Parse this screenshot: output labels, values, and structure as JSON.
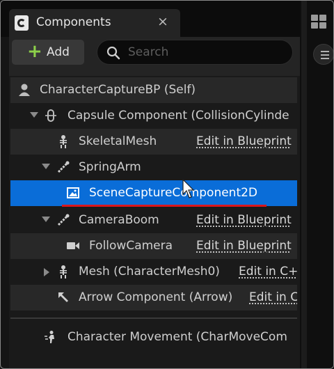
{
  "tab": {
    "title": "Components",
    "close": "×"
  },
  "toolbar": {
    "add_label": "Add",
    "add_plus": "+",
    "search_placeholder": "Search"
  },
  "tree": {
    "rows": [
      {
        "label": "CharacterCaptureBP (Self)",
        "icon": "actor-icon",
        "action": ""
      },
      {
        "label": "Capsule Component (CollisionCylinde",
        "icon": "capsule-icon",
        "action": ""
      },
      {
        "label": "SkeletalMesh",
        "icon": "skeleton-icon",
        "action": "Edit in Blueprint"
      },
      {
        "label": "SpringArm",
        "icon": "spring-arm-icon",
        "action": ""
      },
      {
        "label": "SceneCaptureComponent2D",
        "icon": "scene-capture-icon",
        "action": ""
      },
      {
        "label": "CameraBoom",
        "icon": "spring-arm-icon",
        "action": "Edit in Blueprint"
      },
      {
        "label": "FollowCamera",
        "icon": "camera-icon",
        "action": "Edit in Blueprint"
      },
      {
        "label": "Mesh (CharacterMesh0)",
        "icon": "skeleton-icon",
        "action": "Edit in C+"
      },
      {
        "label": "Arrow Component (Arrow)",
        "icon": "arrow-icon",
        "action": "Edit in C"
      },
      {
        "label": "Character Movement (CharMoveCom",
        "icon": "movement-icon",
        "action": ""
      }
    ]
  },
  "colors": {
    "selection": "#0a6dd8",
    "add_plus": "#8dd14a",
    "annotation_underline": "#d8161c"
  }
}
